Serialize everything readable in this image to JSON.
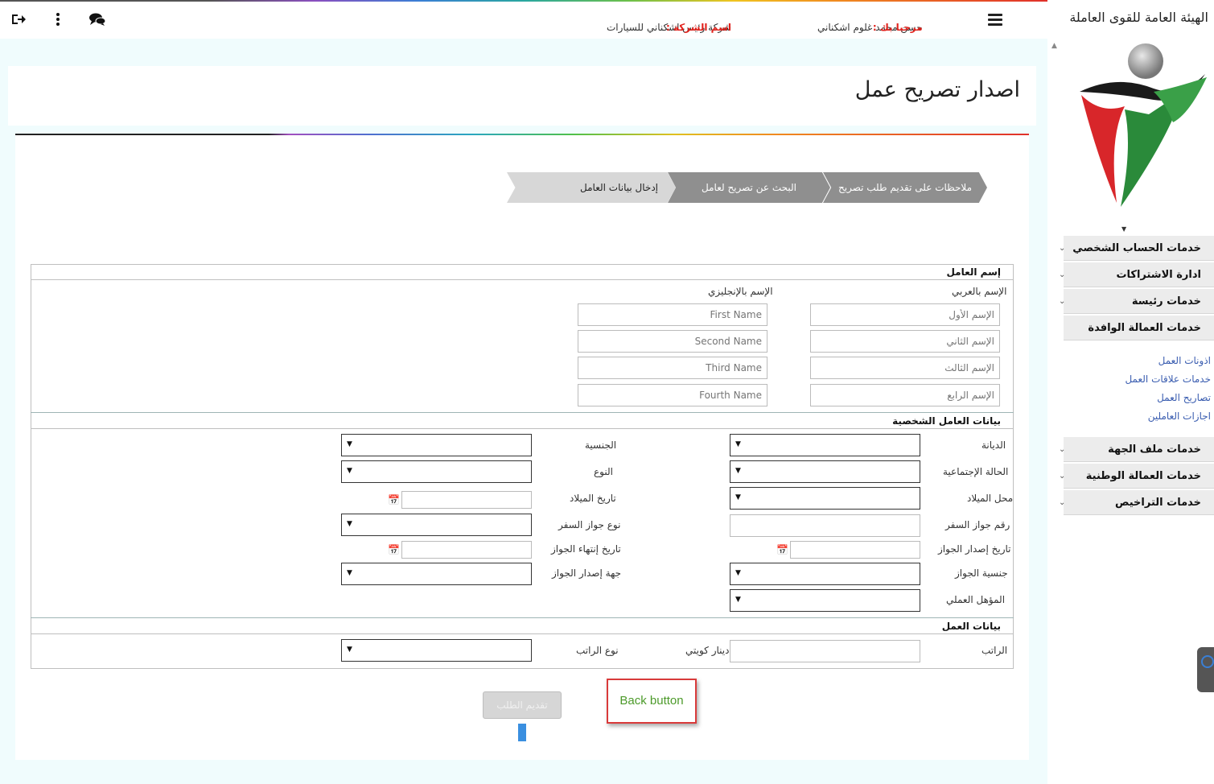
{
  "topbar": {
    "welcome_label": "مرحبا بك :",
    "user_name": "حسن محمد غلوم اشكناني",
    "company_label": "اسم الشركة :",
    "company_name": "شركة رئيس اشكناني للسيارات",
    "icons": [
      "logout-icon",
      "more-vertical-icon",
      "chat-icon",
      "hamburger-menu-icon"
    ]
  },
  "sidebar": {
    "org_title": "الهيئة العامة للقوى العاملة",
    "menu": [
      {
        "label": "خدمات الحساب الشخصي"
      },
      {
        "label": "ادارة الاشتراكات"
      },
      {
        "label": "خدمات رئيسة"
      },
      {
        "label": "خدمات العمالة الوافدة"
      },
      {
        "label": "خدمات ملف الجهة"
      },
      {
        "label": "خدمات العمالة الوطنية"
      },
      {
        "label": "خدمات التراخيص"
      }
    ],
    "submenu": [
      {
        "label": "اذونات العمل"
      },
      {
        "label": "خدمات علاقات العمل"
      },
      {
        "label": "تصاريح العمل"
      },
      {
        "label": "اجازات العاملين"
      }
    ]
  },
  "page": {
    "title": "اصدار تصريح عمل"
  },
  "wizard": {
    "steps": [
      {
        "label": "ملاحظات على تقديم طلب تصريح",
        "state": "done"
      },
      {
        "label": "البحث عن تصريح لعامل",
        "state": "done"
      },
      {
        "label": "إدخال بيانات العامل",
        "state": "active"
      }
    ]
  },
  "form": {
    "name_section": {
      "heading": "إسم العامل",
      "arabic_label": "الإسم بالعربي",
      "english_label": "الإسم بالإنجليزي",
      "arabic_placeholders": [
        "الإسم الأول",
        "الإسم الثاني",
        "الإسم الثالث",
        "الإسم الرابع"
      ],
      "english_placeholders": [
        "First Name",
        "Second Name",
        "Third Name",
        "Fourth Name"
      ]
    },
    "personal_section": {
      "heading": "بيانات العامل الشخصية",
      "religion": "الديانة",
      "nationality": "الجنسية",
      "marital_status": "الحالة الإجتماعية",
      "gender": "النوع",
      "birth_place": "محل الميلاد",
      "birth_date": "تاريخ الميلاد",
      "passport_number": "رقم جواز السفر",
      "passport_type": "نوع جواز السفر",
      "passport_issue_date": "تاريخ إصدار الجواز",
      "passport_expiry_date": "تاريخ إنتهاء الجواز",
      "passport_nationality": "جنسية الجواز",
      "passport_issuer": "جهة إصدار الجواز",
      "qualification": "المؤهل العملي"
    },
    "work_section": {
      "heading": "بيانات العمل",
      "salary": "الراتب",
      "currency": "دينار كويتي",
      "salary_type": "نوع الراتب"
    }
  },
  "actions": {
    "submit_label": "تقديم الطلب",
    "back_callout": "Back button"
  }
}
